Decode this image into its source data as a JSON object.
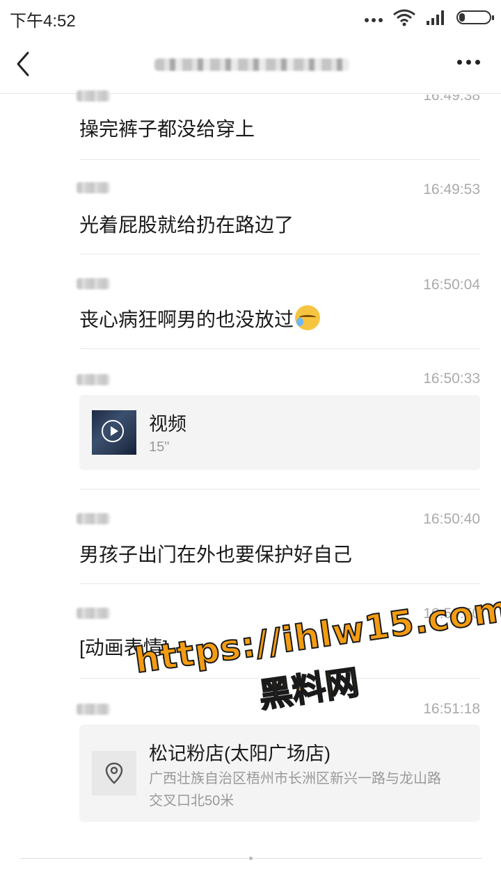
{
  "status": {
    "time": "下午4:52",
    "signal_icon": "signal-icon",
    "wifi_icon": "wifi-icon",
    "battery_icon": "battery-icon"
  },
  "nav": {
    "back_icon": "chevron-left-icon",
    "more_icon": "more-horizontal-icon"
  },
  "messages": [
    {
      "type": "text",
      "time": "16:49:38",
      "text": "操完裤子都没给穿上"
    },
    {
      "type": "text",
      "time": "16:49:53",
      "text": "光着屁股就给扔在路边了"
    },
    {
      "type": "text",
      "time": "16:50:04",
      "text": "丧心病狂啊男的也没放过",
      "emoji": "laughing-crying-emoji"
    },
    {
      "type": "video",
      "time": "16:50:33",
      "title": "视频",
      "duration": "15\""
    },
    {
      "type": "text",
      "time": "16:50:40",
      "text": "男孩子出门在外也要保护好自己"
    },
    {
      "type": "text",
      "time": "16:50:50",
      "text": "[动画表情]"
    },
    {
      "type": "location",
      "time": "16:51:18",
      "title": "松记粉店(太阳广场店)",
      "address_line1": "广西壮族自治区梧州市长洲区新兴一路与龙山路",
      "address_line2": "交叉口北50米"
    }
  ],
  "watermark": {
    "url": "https://ihlw15.com",
    "cn": "黑料网"
  },
  "colors": {
    "watermark_fill": "#f39c12",
    "card_bg": "#f4f4f4",
    "time_gray": "#aaaaaa"
  }
}
